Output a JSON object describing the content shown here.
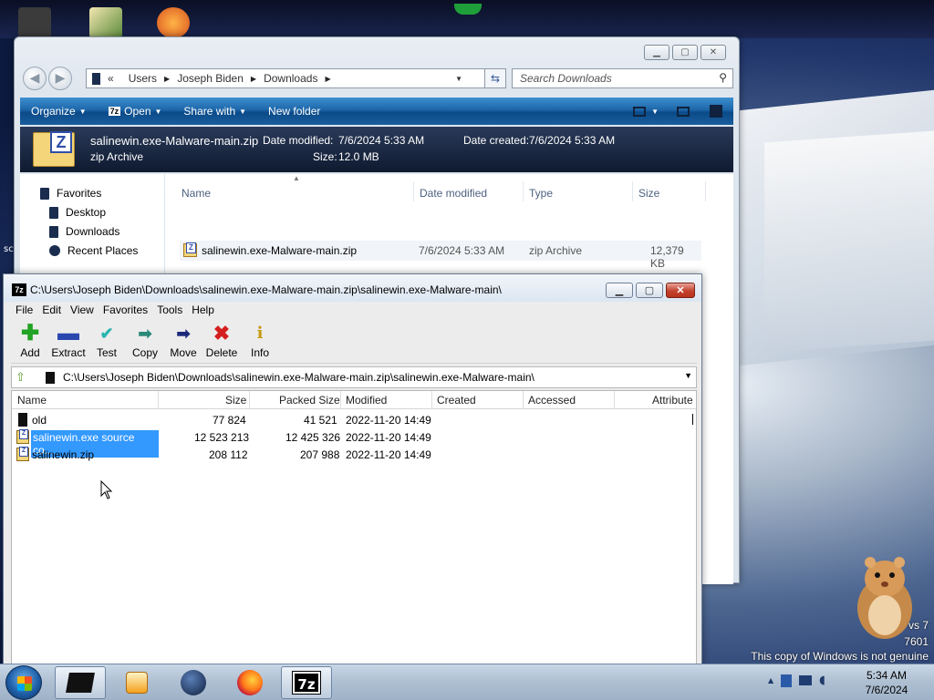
{
  "explorer": {
    "breadcrumb": [
      "Users",
      "Joseph Biden",
      "Downloads"
    ],
    "search_placeholder": "Search Downloads",
    "commands": {
      "organize": "Organize",
      "open": "Open",
      "share_with": "Share with",
      "new_folder": "New folder"
    },
    "details": {
      "filename": "salinewin.exe-Malware-main.zip",
      "date_modified_label": "Date modified:",
      "date_modified": "7/6/2024 5:33 AM",
      "date_created_label": "Date created:",
      "date_created": "7/6/2024 5:33 AM",
      "type": "zip Archive",
      "size_label": "Size:",
      "size": "12.0 MB"
    },
    "nav": {
      "favorites": "Favorites",
      "desktop": "Desktop",
      "downloads": "Downloads",
      "recent": "Recent Places"
    },
    "columns": {
      "name": "Name",
      "date_modified": "Date modified",
      "type": "Type",
      "size": "Size"
    },
    "file": {
      "name": "salinewin.exe-Malware-main.zip",
      "date": "7/6/2024 5:33 AM",
      "type": "zip Archive",
      "size": "12,379 KB"
    }
  },
  "zip": {
    "title": "C:\\Users\\Joseph Biden\\Downloads\\salinewin.exe-Malware-main.zip\\salinewin.exe-Malware-main\\",
    "menu": [
      "File",
      "Edit",
      "View",
      "Favorites",
      "Tools",
      "Help"
    ],
    "toolbar": {
      "add": "Add",
      "extract": "Extract",
      "test": "Test",
      "copy": "Copy",
      "move": "Move",
      "delete": "Delete",
      "info": "Info"
    },
    "path": "C:\\Users\\Joseph Biden\\Downloads\\salinewin.exe-Malware-main.zip\\salinewin.exe-Malware-main\\",
    "columns": {
      "name": "Name",
      "size": "Size",
      "packed": "Packed Size",
      "modified": "Modified",
      "created": "Created",
      "accessed": "Accessed",
      "attributes": "Attribute"
    },
    "rows": [
      {
        "name": "old",
        "size": "77 824",
        "packed": "41 521",
        "modified": "2022-11-20 14:49"
      },
      {
        "name": "salinewin.exe source co...",
        "size": "12 523 213",
        "packed": "12 425 326",
        "modified": "2022-11-20 14:49"
      },
      {
        "name": "salinewin.zip",
        "size": "208 112",
        "packed": "207 988",
        "modified": "2022-11-20 14:49"
      }
    ]
  },
  "taskbar": {
    "time": "5:34 AM",
    "date": "7/6/2024",
    "sevenzip_label": "7z"
  },
  "desktop": {
    "genuine_line1": "vs 7",
    "genuine_line2": "7601",
    "genuine_text": "This copy of Windows is not genuine",
    "left_clip": "sc"
  },
  "colors": {
    "accent": "#1d66a8",
    "selection": "#3399ff",
    "close": "#c3422d"
  }
}
